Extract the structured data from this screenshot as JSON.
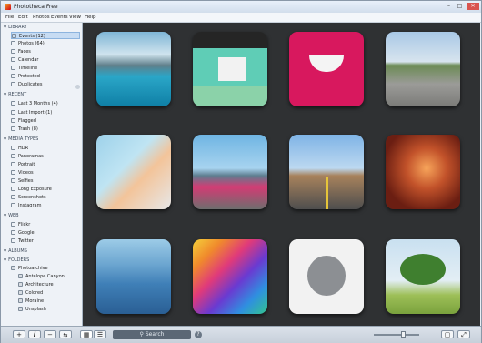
{
  "window": {
    "title": "Phototheca Free"
  },
  "menu": [
    "File",
    "Edit",
    "Photos",
    "Events",
    "View",
    "Help"
  ],
  "sidebar": {
    "library": {
      "title": "LIBRARY",
      "items": [
        "Events (12)",
        "Photos (64)",
        "Faces",
        "Calendar",
        "Timeline",
        "Protected",
        "Duplicates"
      ]
    },
    "recent": {
      "title": "RECENT",
      "items": [
        "Last 3 Months (4)",
        "Last Import (1)",
        "Flagged",
        "Trash (8)"
      ]
    },
    "media_types": {
      "title": "MEDIA TYPES",
      "items": [
        "HDR",
        "Panoramas",
        "Portrait",
        "Videos",
        "Selfies",
        "Long Exposure",
        "Screenshots",
        "Instagram"
      ]
    },
    "web": {
      "title": "WEB",
      "items": [
        "Flickr",
        "Google",
        "Twitter"
      ]
    },
    "albums": {
      "title": "ALBUMS"
    },
    "folders": {
      "title": "FOLDERS",
      "root": "Photoarchive",
      "items": [
        "Antelope Canyon",
        "Architecture",
        "Colored",
        "Moraine",
        "Unsplash"
      ]
    }
  },
  "toolbar": {
    "add": "+",
    "info": "i",
    "remove": "−",
    "link": "⇆",
    "search_label": "Search",
    "help": "?"
  },
  "colors": {
    "gallery_bg": "#2f3133",
    "selection": "#c7dcf3",
    "accent": "#8db4de"
  },
  "zoom_level": 0.6
}
